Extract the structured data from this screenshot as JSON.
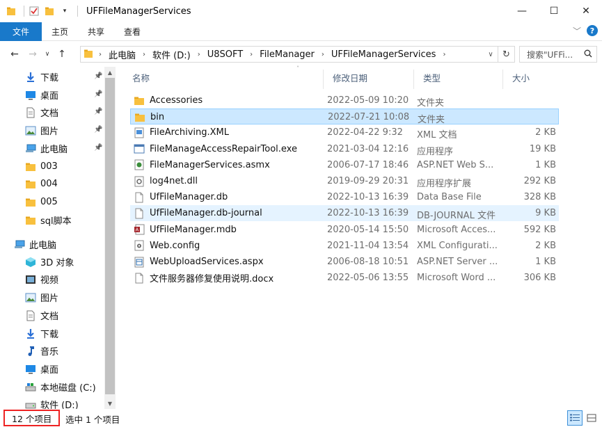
{
  "window": {
    "title": "UFFileManagerServices",
    "controls": {
      "minimize": "—",
      "maximize": "☐",
      "close": "✕"
    }
  },
  "ribbon": {
    "tabs": [
      "文件",
      "主页",
      "共享",
      "查看"
    ]
  },
  "address": {
    "breadcrumbs": [
      "此电脑",
      "软件 (D:)",
      "U8SOFT",
      "FileManager",
      "UFFileManagerServices"
    ],
    "search_placeholder": "搜索\"UFFi..."
  },
  "nav": {
    "items": [
      {
        "label": "下载",
        "icon": "download-icon",
        "pinned": true
      },
      {
        "label": "桌面",
        "icon": "desktop-icon",
        "pinned": true
      },
      {
        "label": "文档",
        "icon": "document-icon",
        "pinned": true
      },
      {
        "label": "图片",
        "icon": "pictures-icon",
        "pinned": true
      },
      {
        "label": "此电脑",
        "icon": "computer-icon",
        "pinned": true
      },
      {
        "label": "003",
        "icon": "folder-icon",
        "pinned": false
      },
      {
        "label": "004",
        "icon": "folder-icon",
        "pinned": false
      },
      {
        "label": "005",
        "icon": "folder-icon",
        "pinned": false
      },
      {
        "label": "sql脚本",
        "icon": "folder-icon",
        "pinned": false
      },
      {
        "label": "此电脑",
        "icon": "computer-icon",
        "pinned": false
      },
      {
        "label": "3D 对象",
        "icon": "3d-objects-icon",
        "pinned": false
      },
      {
        "label": "视频",
        "icon": "video-icon",
        "pinned": false
      },
      {
        "label": "图片",
        "icon": "pictures-icon",
        "pinned": false
      },
      {
        "label": "文档",
        "icon": "document-icon",
        "pinned": false
      },
      {
        "label": "下载",
        "icon": "download-icon",
        "pinned": false
      },
      {
        "label": "音乐",
        "icon": "music-icon",
        "pinned": false
      },
      {
        "label": "桌面",
        "icon": "desktop-icon",
        "pinned": false
      },
      {
        "label": "本地磁盘 (C:)",
        "icon": "local-disk-icon",
        "pinned": false
      },
      {
        "label": "软件 (D:)",
        "icon": "drive-icon",
        "pinned": false
      }
    ]
  },
  "files": {
    "columns": {
      "name": "名称",
      "date": "修改日期",
      "type": "类型",
      "size": "大小"
    },
    "rows": [
      {
        "name": "Accessories",
        "date": "2022-05-09 10:20",
        "type": "文件夹",
        "size": "",
        "icon": "folder-icon"
      },
      {
        "name": "bin",
        "date": "2022-07-21 10:08",
        "type": "文件夹",
        "size": "",
        "icon": "folder-icon"
      },
      {
        "name": "FileArchiving.XML",
        "date": "2022-04-22 9:32",
        "type": "XML 文档",
        "size": "2 KB",
        "icon": "xml-file-icon"
      },
      {
        "name": "FileManageAccessRepairTool.exe",
        "date": "2021-03-04 12:16",
        "type": "应用程序",
        "size": "19 KB",
        "icon": "exe-file-icon"
      },
      {
        "name": "FileManagerServices.asmx",
        "date": "2006-07-17 18:46",
        "type": "ASP.NET Web S...",
        "size": "1 KB",
        "icon": "asmx-file-icon"
      },
      {
        "name": "log4net.dll",
        "date": "2019-09-29 20:31",
        "type": "应用程序扩展",
        "size": "292 KB",
        "icon": "dll-file-icon"
      },
      {
        "name": "UfFileManager.db",
        "date": "2022-10-13 16:39",
        "type": "Data Base File",
        "size": "328 KB",
        "icon": "file-icon"
      },
      {
        "name": "UfFileManager.db-journal",
        "date": "2022-10-13 16:39",
        "type": "DB-JOURNAL 文件",
        "size": "9 KB",
        "icon": "file-icon"
      },
      {
        "name": "UfFileManager.mdb",
        "date": "2020-05-14 15:50",
        "type": "Microsoft Acces...",
        "size": "592 KB",
        "icon": "access-file-icon"
      },
      {
        "name": "Web.config",
        "date": "2021-11-04 13:54",
        "type": "XML Configurati...",
        "size": "2 KB",
        "icon": "config-file-icon"
      },
      {
        "name": "WebUploadServices.aspx",
        "date": "2006-08-18 10:51",
        "type": "ASP.NET Server ...",
        "size": "1 KB",
        "icon": "aspx-file-icon"
      },
      {
        "name": "文件服务器修复使用说明.docx",
        "date": "2022-05-06 13:55",
        "type": "Microsoft Word ...",
        "size": "306 KB",
        "icon": "file-icon"
      }
    ]
  },
  "status": {
    "item_count": "12 个项目",
    "selected": "选中 1 个项目"
  },
  "colors": {
    "accent": "#1979ca",
    "selection": "#cce8ff",
    "highlight_box": "#ee2222"
  }
}
